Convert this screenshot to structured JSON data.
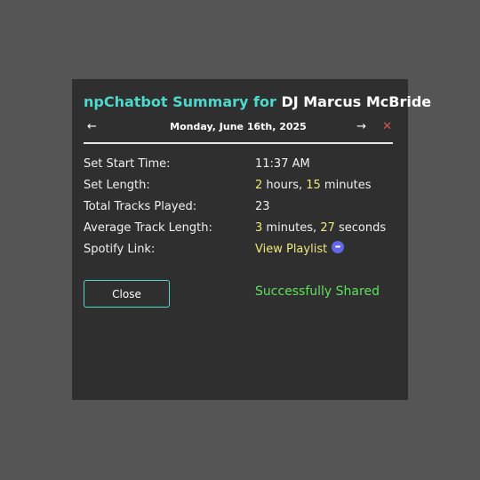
{
  "header": {
    "title_prefix": "npChatbot Summary for",
    "title_name": "DJ Marcus McBride",
    "date": "Monday, June 16th, 2025",
    "prev_icon": "←",
    "next_icon": "→",
    "close_icon": "✕"
  },
  "summary": {
    "start_time_label": "Set Start Time:",
    "start_time_value": "11:37 AM",
    "length_label": "Set Length:",
    "length_hours": "2",
    "length_hours_unit": " hours, ",
    "length_minutes": "15",
    "length_minutes_unit": " minutes",
    "tracks_label": "Total Tracks Played:",
    "tracks_value": "23",
    "avg_label": "Average Track Length:",
    "avg_minutes": "3",
    "avg_minutes_unit": " minutes, ",
    "avg_seconds": "27",
    "avg_seconds_unit": " seconds",
    "spotify_label": "Spotify Link:",
    "spotify_link_text": "View Playlist"
  },
  "footer": {
    "close_label": "Close",
    "status_text": "Successfully Shared"
  },
  "colors": {
    "accent": "#4fd8cc",
    "value": "#eee87a",
    "success": "#5fe05f",
    "danger": "#d9534f",
    "share_icon": "#6366e8"
  }
}
